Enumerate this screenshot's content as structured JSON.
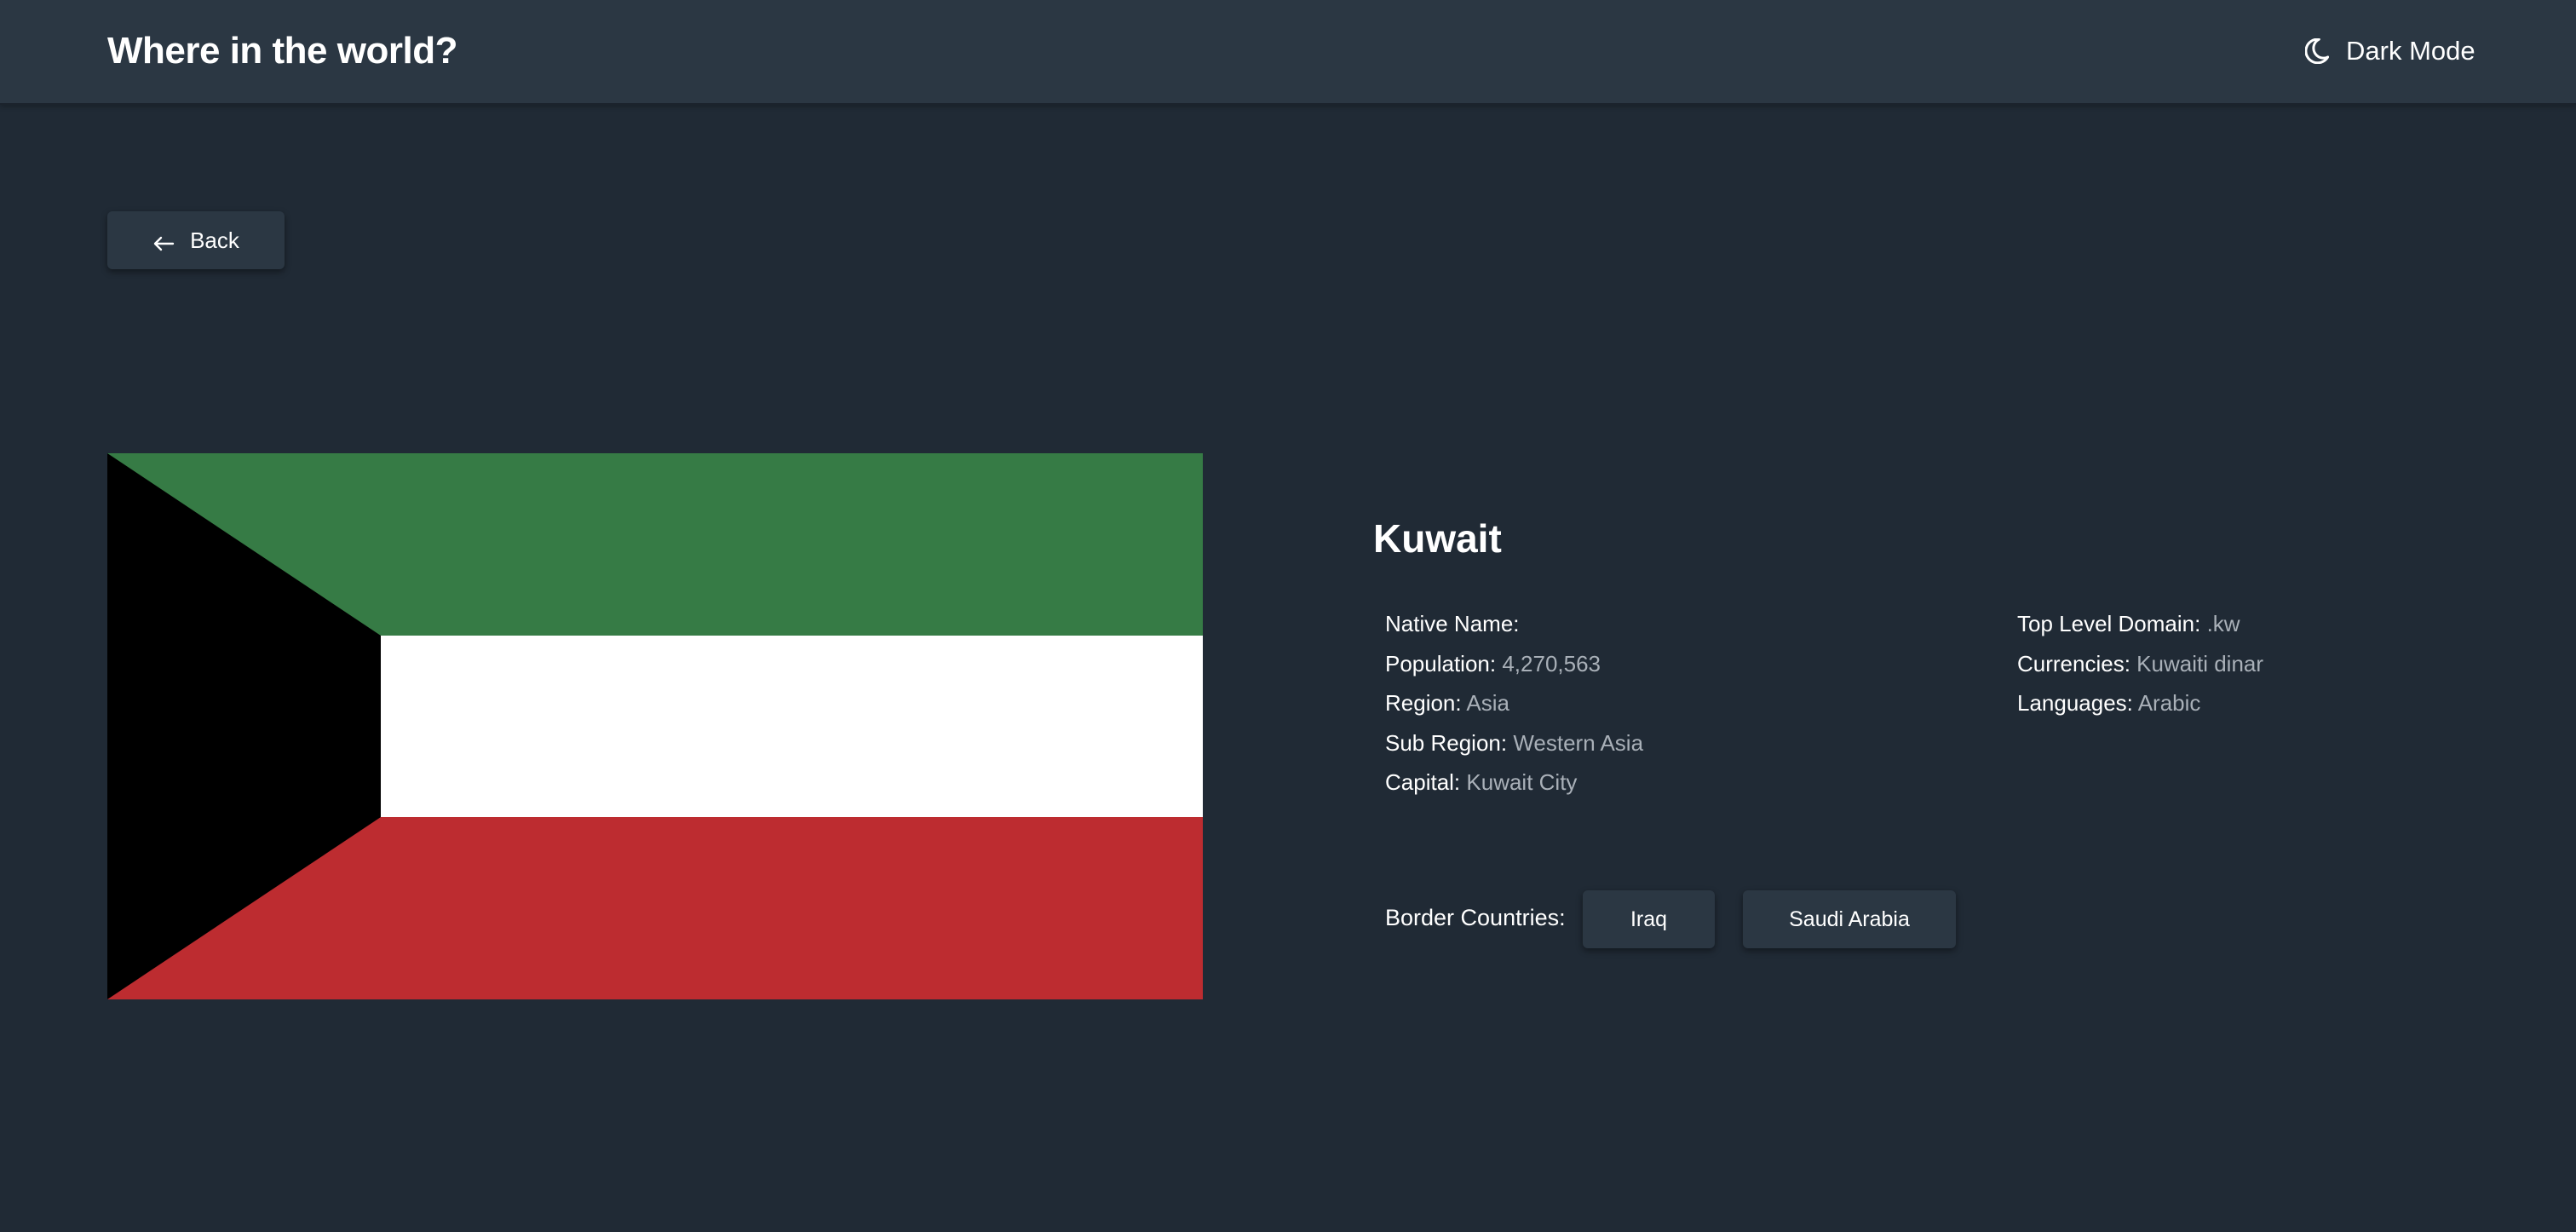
{
  "header": {
    "title": "Where in the world?",
    "theme_toggle_label": "Dark Mode",
    "theme_icon": "moon-icon"
  },
  "back_button": {
    "label": "Back",
    "icon": "arrow-left-icon"
  },
  "flag": {
    "country": "Kuwait",
    "colors": {
      "green": "#367b45",
      "white": "#ffffff",
      "red": "#bd2c30",
      "black": "#000000"
    }
  },
  "country": {
    "name": "Kuwait",
    "left_info": [
      {
        "label": "Native Name:",
        "value": ""
      },
      {
        "label": "Population:",
        "value": "4,270,563"
      },
      {
        "label": "Region:",
        "value": "Asia"
      },
      {
        "label": "Sub Region:",
        "value": "Western Asia"
      },
      {
        "label": "Capital:",
        "value": "Kuwait City"
      }
    ],
    "right_info": [
      {
        "label": "Top Level Domain:",
        "value": ".kw"
      },
      {
        "label": "Currencies:",
        "value": "Kuwaiti dinar"
      },
      {
        "label": "Languages:",
        "value": "Arabic"
      }
    ],
    "border_label": "Border Countries:",
    "border_countries": [
      "Iraq",
      "Saudi Arabia"
    ]
  },
  "colors": {
    "background": "#202a35",
    "surface": "#2b3743",
    "text": "#ffffff",
    "muted_text": "#a9b0b8"
  }
}
